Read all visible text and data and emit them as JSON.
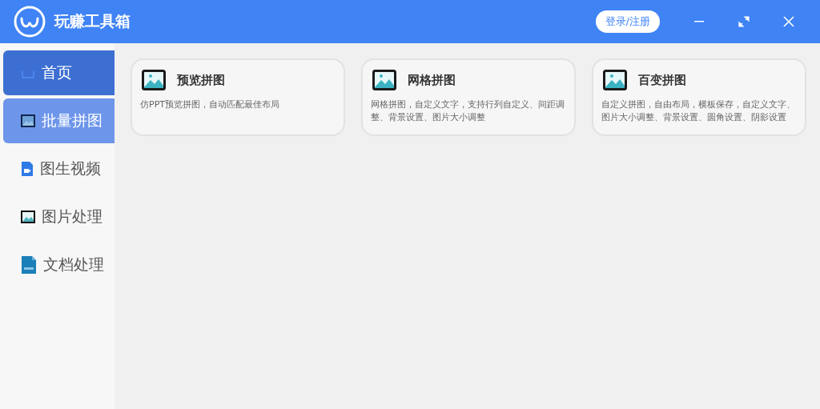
{
  "app": {
    "title": "玩赚工具箱",
    "login_button": "登录/注册"
  },
  "sidebar": {
    "items": [
      {
        "label": "首页",
        "kind": "home",
        "selected": false,
        "hovered": true
      },
      {
        "label": "批量拼图",
        "kind": "image",
        "selected": true,
        "hovered": false
      },
      {
        "label": "图生视频",
        "kind": "video",
        "selected": false,
        "hovered": false
      },
      {
        "label": "图片处理",
        "kind": "picture",
        "selected": false,
        "hovered": false
      },
      {
        "label": "文档处理",
        "kind": "doc",
        "selected": false,
        "hovered": false
      }
    ]
  },
  "cards": [
    {
      "title": "预览拼图",
      "description": "仿PPT预览拼图，自动匹配最佳布局"
    },
    {
      "title": "网格拼图",
      "description": "网格拼图，自定义文字，支持行列自定义、间距调整、背景设置、图片大小调整"
    },
    {
      "title": "百变拼图",
      "description": "自定义拼图，自由布局，横板保存，自定义文字、图片大小调整、背景设置、圆角设置、阴影设置"
    }
  ]
}
